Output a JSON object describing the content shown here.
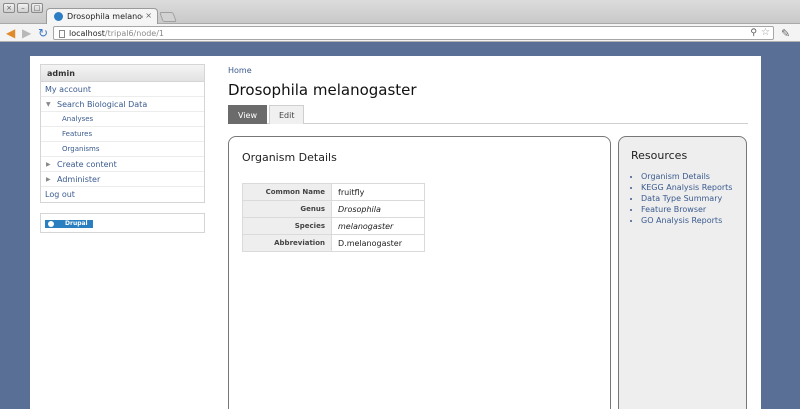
{
  "browser": {
    "window_buttons": [
      "×",
      "–",
      "□"
    ],
    "tab_title": "Drosophila melanogaste",
    "tab_close": "×",
    "url_host": "localhost",
    "url_path": "/tripal6/node/1",
    "icons": {
      "back": "◀",
      "forward": "▶",
      "reload": "↻",
      "zoom": "⚲",
      "star": "☆",
      "wrench": "✎"
    }
  },
  "sidebar": {
    "user_block_title": "admin",
    "menu": [
      {
        "label": "My account"
      },
      {
        "label": "Search Biological Data",
        "arrow": "▼"
      },
      {
        "label": "Analyses"
      },
      {
        "label": "Features"
      },
      {
        "label": "Organisms"
      },
      {
        "label": "Create content",
        "arrow": "▶"
      },
      {
        "label": "Administer",
        "arrow": "▶"
      },
      {
        "label": "Log out"
      }
    ],
    "drupal_badge": "Drupal"
  },
  "breadcrumb": "Home",
  "page_title": "Drosophila melanogaster",
  "tabs": [
    "View",
    "Edit"
  ],
  "organism_details": {
    "title": "Organism Details",
    "rows": [
      {
        "label": "Common Name",
        "value": "fruitfly"
      },
      {
        "label": "Genus",
        "value": "Drosophila"
      },
      {
        "label": "Species",
        "value": "melanogaster"
      },
      {
        "label": "Abbreviation",
        "value": "D.melanogaster"
      }
    ]
  },
  "resources": {
    "title": "Resources",
    "links": [
      "Organism Details",
      "KEGG Analysis Reports",
      "Data Type Summary",
      "Feature Browser",
      "GO Analysis Reports"
    ]
  }
}
